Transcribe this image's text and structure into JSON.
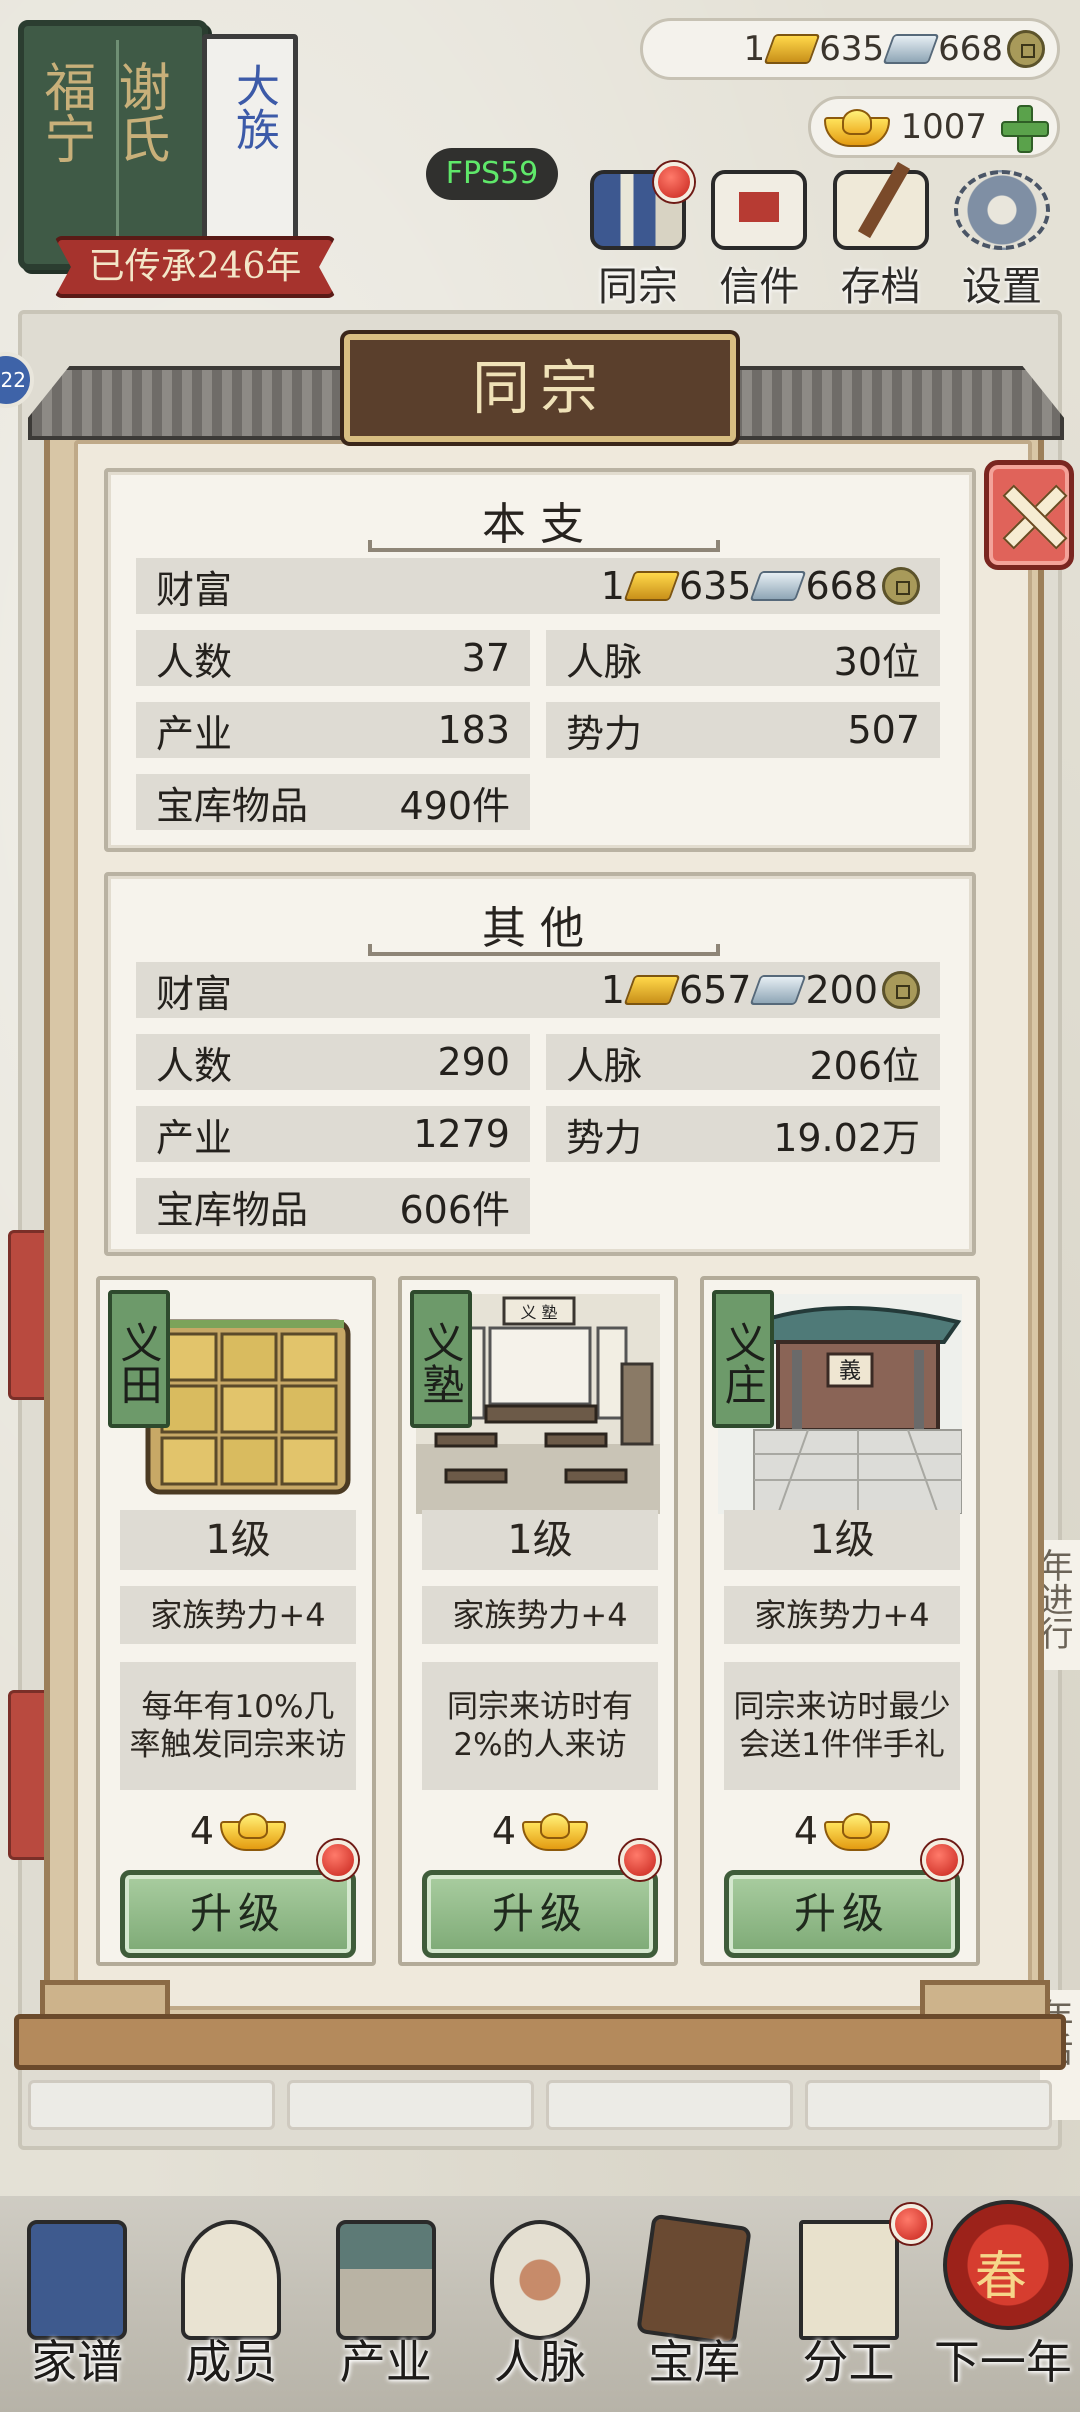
{
  "clan": {
    "book_left": "福宁",
    "book_right": "谢氏",
    "paper": "大族",
    "inherited": "已传承246年"
  },
  "fps": "FPS59",
  "currency": {
    "gold": "1",
    "silver": "635",
    "copper": "668",
    "yuanbao": "1007"
  },
  "top_nav": [
    {
      "label": "同宗",
      "icon": "clan-book-icon",
      "badge": true
    },
    {
      "label": "信件",
      "icon": "letter-icon",
      "badge": false
    },
    {
      "label": "存档",
      "icon": "save-icon",
      "badge": false
    },
    {
      "label": "设置",
      "icon": "gear-icon",
      "badge": false
    }
  ],
  "side_badge": "22",
  "panel": {
    "title": "同宗",
    "main": {
      "heading": "本支",
      "wealth_label": "财富",
      "wealth_gold": "1",
      "wealth_silver": "635",
      "wealth_copper": "668",
      "people_label": "人数",
      "people": "37",
      "network_label": "人脉",
      "network": "30位",
      "industry_label": "产业",
      "industry": "183",
      "power_label": "势力",
      "power": "507",
      "treasury_label": "宝库物品",
      "treasury": "490件"
    },
    "other": {
      "heading": "其他",
      "wealth_label": "财富",
      "wealth_gold": "1",
      "wealth_silver": "657",
      "wealth_copper": "200",
      "people_label": "人数",
      "people": "290",
      "network_label": "人脉",
      "network": "206位",
      "industry_label": "产业",
      "industry": "1279",
      "power_label": "势力",
      "power": "19.02万",
      "treasury_label": "宝库物品",
      "treasury": "606件"
    }
  },
  "buildings": [
    {
      "tag": "义田",
      "level": "1级",
      "bonus": "家族势力+4",
      "desc": "每年有10%几率触发同宗来访",
      "cost": "4",
      "button": "升级"
    },
    {
      "tag": "义塾",
      "level": "1级",
      "bonus": "家族势力+4",
      "desc": "同宗来访时有2%的人来访",
      "cost": "4",
      "button": "升级",
      "sign": "义 塾"
    },
    {
      "tag": "义庄",
      "level": "1级",
      "bonus": "家族势力+4",
      "desc": "同宗来访时最少会送1件伴手礼",
      "cost": "4",
      "button": "升级",
      "sign": "義"
    }
  ],
  "bottom_nav": [
    {
      "label": "家谱",
      "badge": false
    },
    {
      "label": "成员",
      "badge": false
    },
    {
      "label": "产业",
      "badge": false
    },
    {
      "label": "人脉",
      "badge": false
    },
    {
      "label": "宝库",
      "badge": false
    },
    {
      "label": "分工",
      "badge": true
    },
    {
      "label": "下一年",
      "badge": false,
      "glyph": "春"
    }
  ],
  "background_fragments": {
    "right_top": "年进行",
    "right_bottom": "年后"
  },
  "colors": {
    "accent_red": "#c6241c",
    "upgrade_green": "#7eaa76",
    "plate_brown": "#5a3f2c",
    "fps_green": "#5fe86a"
  }
}
